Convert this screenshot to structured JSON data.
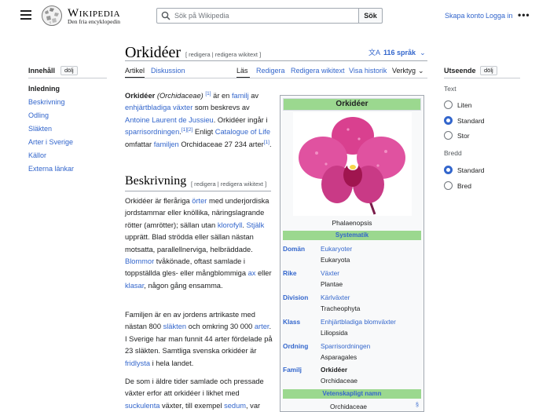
{
  "header": {
    "wordmark": "Wikipedia",
    "tagline": "Den fria encyklopedin",
    "search_placeholder": "Sök på Wikipedia",
    "search_button": "Sök",
    "create_account": "Skapa konto",
    "login": "Logga in",
    "more": "•••"
  },
  "toc": {
    "heading": "Innehåll",
    "hide": "dölj",
    "items": [
      "Inledning",
      "Beskrivning",
      "Odling",
      "Släkten",
      "Arter i Sverige",
      "Källor",
      "Externa länkar"
    ]
  },
  "article": {
    "title": "Orkidéer",
    "title_edit": "[ redigera | redigera wikitext ]",
    "languages": "116 språk",
    "tabs_left": [
      "Artikel",
      "Diskussion"
    ],
    "tabs_right": [
      "Läs",
      "Redigera",
      "Redigera wikitext",
      "Visa historik",
      "Verktyg"
    ],
    "intro": {
      "bold": "Orkidéer",
      "italic": "(Orchidaceae)",
      "ref1": "[1]",
      "t1": " är en ",
      "l1": "familj",
      "t2": " av ",
      "l2": "enhjärtbladiga växter",
      "t3": " som beskrevs av ",
      "l3": "Antoine Laurent de Jussieu",
      "t4": ". Orkidéer ingår i ",
      "l4": "sparrisordningen",
      "ref2": "[1][2]",
      "t5": " Enligt ",
      "l5": "Catalogue of Life",
      "t6": " omfattar ",
      "l6": "familjen",
      "t7": " Orchidaceae 27 234 arter",
      "ref3": "[1]",
      "t8": "."
    },
    "section_title": "Beskrivning",
    "section_edit": "[ redigera | redigera wikitext ]",
    "p1": {
      "t1": "Orkidéer är fleråriga ",
      "l1": "örter",
      "t2": " med underjordiska jordstammar eller knöllika, näringslagrande rötter (amrötter); sällan utan ",
      "l2": "klorofyll",
      "t3": ". ",
      "l3": "Stjälk",
      "t4": " upprätt. Blad strödda eller sällan nästan motsatta, parallellnerviga, helbräddade. ",
      "l4": "Blommor",
      "t5": " tvåkönade, oftast samlade i toppställda gles- eller mångblommiga ",
      "l5": "ax",
      "t6": " eller ",
      "l6": "klasar",
      "t7": ", någon gång ensamma."
    },
    "p2": {
      "t1": "Familjen är en av jordens artrikaste med nästan 800 ",
      "l1": "släkten",
      "t2": " och omkring 30 000 ",
      "l2": "arter",
      "t3": ". I Sverige har man funnit 44 arter fördelade på 23 släkten. Samtliga svenska orkidéer är ",
      "l3": "fridlysta",
      "t4": " i hela landet."
    },
    "p3": {
      "t1": "De som i äldre tider samlade och pressade växter erfor att orkidéer i likhet med ",
      "l1": "suckulenta",
      "t2": " växter, till exempel ",
      "l2": "sedum",
      "t3": ", var"
    }
  },
  "infobox": {
    "title": "Orkidéer",
    "caption": "Phalaenopsis",
    "systematik": "Systematik",
    "rows": [
      {
        "key": "Domän",
        "val": "Eukaryoter",
        "sub": "Eukaryota"
      },
      {
        "key": "Rike",
        "val": "Växter",
        "sub": "Plantae"
      },
      {
        "key": "Division",
        "val": "Kärlväxter",
        "sub": "Tracheophyta"
      },
      {
        "key": "Klass",
        "val": "Enhjärtbladiga blomväxter",
        "sub": "Liliopsida"
      },
      {
        "key": "Ordning",
        "val": "Sparrisordningen",
        "sub": "Asparagales"
      },
      {
        "key": "Familj",
        "val": "Orkidéer",
        "sub": "Orchidaceae"
      }
    ],
    "scientific_name": "Vetenskapligt namn",
    "scientific_value": "Orchidaceae",
    "scientific_mark": "§"
  },
  "appearance": {
    "heading": "Utseende",
    "hide": "dölj",
    "text_label": "Text",
    "text_options": [
      "Liten",
      "Standard",
      "Stor"
    ],
    "text_selected": "Standard",
    "width_label": "Bredd",
    "width_options": [
      "Standard",
      "Bred"
    ],
    "width_selected": "Standard"
  },
  "colors": {
    "link": "#3366cc",
    "infobox_green": "#9bd88f",
    "orchid_pink": "#d9408f"
  }
}
